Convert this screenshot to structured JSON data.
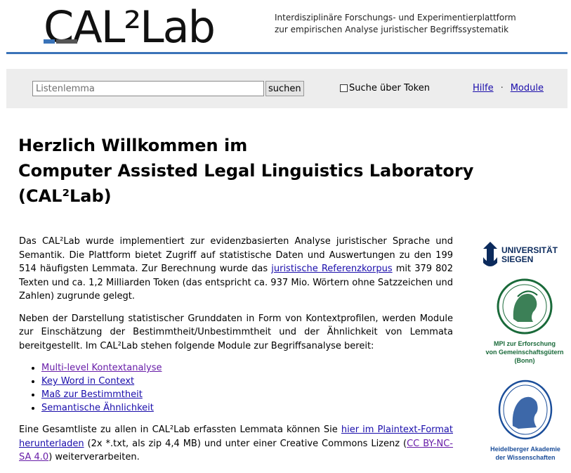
{
  "header": {
    "logo_text": "CAL²Lab",
    "tagline_line1": "Interdisziplinäre Forschungs- und Experimentierplattform",
    "tagline_line2": "zur empirischen Analyse juristischer Begriffssystematik"
  },
  "search": {
    "placeholder": "Listenlemma",
    "button_label": "suchen",
    "token_checkbox_label": "Suche über Token",
    "token_checkbox_checked": false
  },
  "nav": {
    "help_label": "Hilfe",
    "separator": "·",
    "modules_label": "Module"
  },
  "main": {
    "title_line1": "Herzlich Willkommen im",
    "title_line2": "Computer Assisted Legal Linguistics Laboratory",
    "title_line3": "(CAL²Lab)",
    "p1_part1": "Das CAL²Lab wurde implementiert zur evidenzbasierten Analyse juristischer Sprache und Semantik. Die Plattform bietet Zugriff auf statistische Daten und Auswertungen zu den 199 514 häufigsten Lemmata. Zur Berechnung wurde das ",
    "p1_link": "juristische Referenzkorpus",
    "p1_part2": " mit 379 802 Texten und ca. 1,2 Milliarden Token (das entspricht ca. 937 Mio. Wörtern ohne Satzzeichen und Zahlen) zugrunde gelegt.",
    "p2": "Neben der Darstellung statistischer Grunddaten in Form von Kontextprofilen, werden Module zur Einschätzung der Bestimmtheit/Unbestimmtheit und der Ähnlichkeit von Lemmata bereitgestellt. Im CAL²Lab stehen folgende Module zur Begriffsanalyse bereit:",
    "modules": [
      "Multi-level Kontextanalyse",
      "Key Word in Context",
      "Maß zur Bestimmtheit",
      "Semantische Ähnlichkeit"
    ],
    "p3_part1": "Eine Gesamtliste zu allen in CAL²Lab erfassten Lemmata können Sie ",
    "p3_link1": "hier im Plaintext-Format herunterladen",
    "p3_part2": " (2x *.txt, als zip 4,4 MB) und unter einer Creative Commons Lizenz (",
    "p3_link2": "CC BY-NC-SA 4.0",
    "p3_part3": ") weiterverarbeiten."
  },
  "logos": {
    "siegen_line1": "UNIVERSITÄT",
    "siegen_line2": "SIEGEN",
    "mpi_caption": [
      "MPI zur Erforschung",
      "von Gemeinschaftsgütern",
      "(Bonn)"
    ],
    "hdaw_caption": [
      "Heidelberger Akademie",
      "der Wissenschaften"
    ]
  },
  "colors": {
    "accent": "#3a73b8",
    "link": "#1a0dab",
    "visited_link": "#681da8",
    "searchbar_bg": "#ededed",
    "mpi_green": "#1a6a3a",
    "hdaw_blue": "#1b4e9a",
    "siegen_navy": "#0b2a5c"
  }
}
